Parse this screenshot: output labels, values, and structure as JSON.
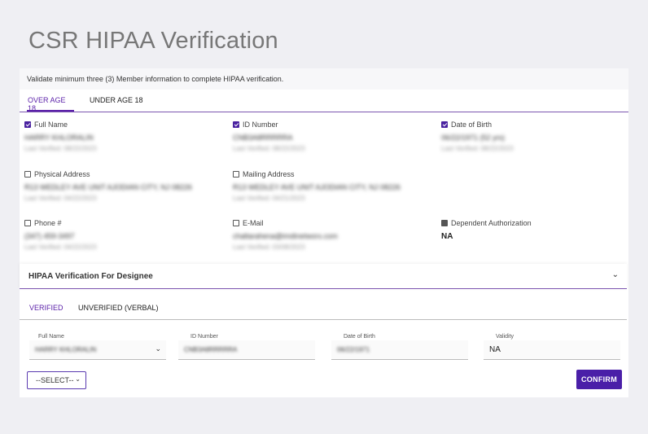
{
  "page": {
    "title": "CSR HIPAA Verification"
  },
  "instructions": "Validate minimum three (3) Member information to complete HIPAA verification.",
  "age_tabs": [
    {
      "label": "OVER AGE 18",
      "active": true
    },
    {
      "label": "UNDER AGE 18",
      "active": false
    }
  ],
  "fields": {
    "full_name": {
      "label": "Full Name",
      "checked": true,
      "value": "HARRY KHLORALIN",
      "last_verified": "Last Verified: 08/22/2023"
    },
    "id_number": {
      "label": "ID Number",
      "checked": true,
      "value": "CNB3A8RRRRRA",
      "last_verified": "Last Verified: 08/22/2023"
    },
    "dob": {
      "label": "Date of Birth",
      "checked": true,
      "value": "06/22/1971 (52 yrs)",
      "last_verified": "Last Verified: 08/22/2023"
    },
    "physical_address": {
      "label": "Physical Address",
      "checked": false,
      "value": "R13 WEDLEY AVE UNIT AJODIAN CITY, NJ 08226",
      "last_verified": "Last Verified: 04/22/2023"
    },
    "mailing_address": {
      "label": "Mailing Address",
      "checked": false,
      "value": "R13 WEDLEY AVE UNIT AJODIAN CITY, NJ 08226",
      "last_verified": "Last Verified: 04/21/2023"
    },
    "phone": {
      "label": "Phone #",
      "checked": false,
      "value": "(347) 459-3497",
      "last_verified": "Last Verified: 04/22/2023"
    },
    "email": {
      "label": "E-Mail",
      "checked": false,
      "value": "chaltarahena@imdinetworx.com",
      "last_verified": "Last Verified: 03/08/2023"
    },
    "dependent_auth": {
      "label": "Dependent Authorization",
      "value": "NA"
    }
  },
  "designee": {
    "section_title": "HIPAA Verification For Designee",
    "tabs": [
      {
        "label": "VERIFIED",
        "active": true
      },
      {
        "label": "UNVERIFIED (VERBAL)",
        "active": false
      }
    ],
    "full_name": {
      "label": "Full Name",
      "value": "HARRY KHLORALIN"
    },
    "id_number": {
      "label": "ID Number",
      "value": "CNB3A8RRRRRA"
    },
    "dob": {
      "label": "Date of Birth",
      "value": "06/22/1971"
    },
    "validity": {
      "label": "Validity",
      "value": "NA"
    }
  },
  "actions": {
    "select_label": "--SELECT--",
    "confirm_label": "CONFIRM"
  },
  "colors": {
    "accent": "#5a1fa8",
    "button": "#4a1fa8",
    "background": "#efeff3"
  }
}
